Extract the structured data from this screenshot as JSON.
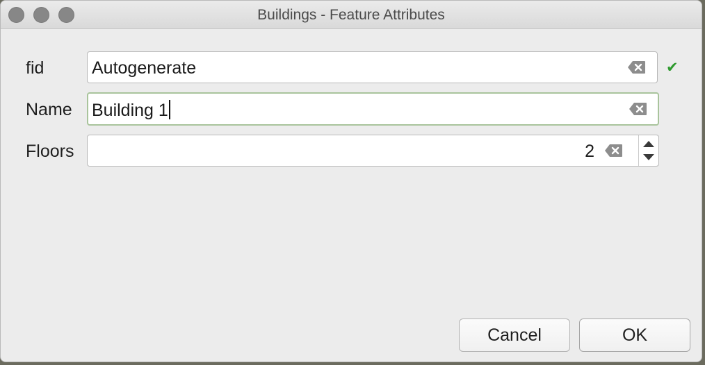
{
  "window": {
    "title": "Buildings - Feature Attributes"
  },
  "form": {
    "fields": [
      {
        "label": "fid",
        "value": "Autogenerate",
        "valid": true
      },
      {
        "label": "Name",
        "value": "Building 1"
      },
      {
        "label": "Floors",
        "value": "2"
      }
    ]
  },
  "icons": {
    "clear": "backspace-clear-icon",
    "valid": "checkmark-icon",
    "valid_glyph": "✔",
    "spin": "spinbox-arrows-icon"
  },
  "colors": {
    "valid": "#2e9a2e",
    "focus_border": "#a9c49c"
  },
  "buttons": {
    "cancel_label": "Cancel",
    "ok_label": "OK"
  }
}
